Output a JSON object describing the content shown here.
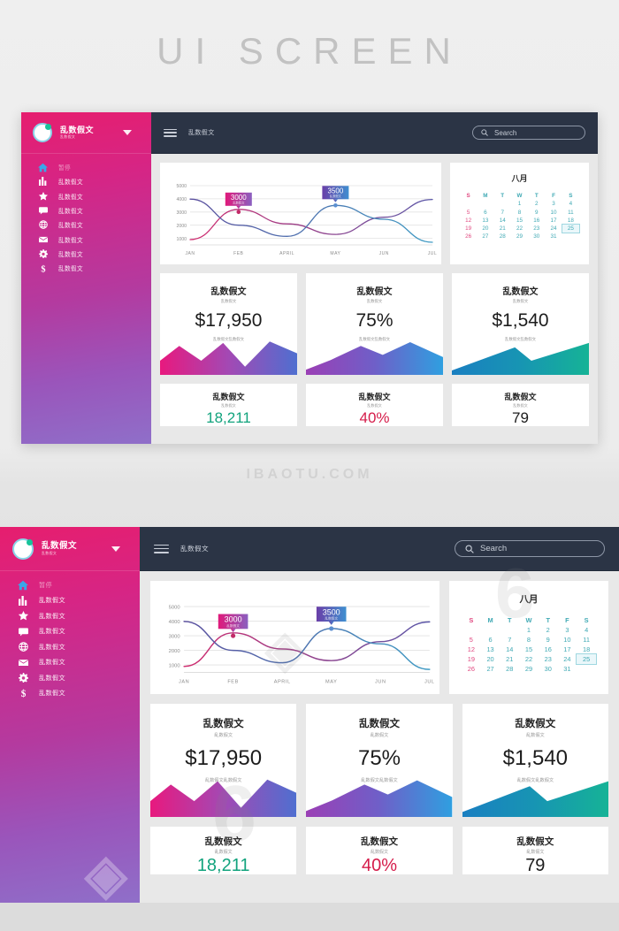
{
  "banner": {
    "title": "UI SCREEN"
  },
  "watermark": {
    "site": "IBAOTU.COM",
    "glyph": "6",
    "diamond": "◈"
  },
  "brand": {
    "name": "乱数假文",
    "subtitle": "乱数假文",
    "caret_icon": "chevron-down-icon",
    "logo_icon": "ring-logo-icon"
  },
  "sidebar": {
    "items": [
      {
        "label": "暂停",
        "icon": "home-icon",
        "active": true
      },
      {
        "label": "乱数假文",
        "icon": "bar-chart-icon",
        "active": false
      },
      {
        "label": "乱数假文",
        "icon": "star-icon",
        "active": false
      },
      {
        "label": "乱数假文",
        "icon": "chat-icon",
        "active": false
      },
      {
        "label": "乱数假文",
        "icon": "globe-icon",
        "active": false
      },
      {
        "label": "乱数假文",
        "icon": "envelope-icon",
        "active": false
      },
      {
        "label": "乱数假文",
        "icon": "gear-icon",
        "active": false
      },
      {
        "label": "乱数假文",
        "icon": "dollar-icon",
        "active": false
      }
    ]
  },
  "topbar": {
    "menu_icon": "hamburger-icon",
    "title": "乱数假文",
    "search": {
      "placeholder": "Search",
      "icon": "search-icon",
      "value": ""
    }
  },
  "calendar": {
    "title": "八月",
    "weekdays": [
      "S",
      "M",
      "T",
      "W",
      "T",
      "F",
      "S"
    ],
    "lead_blanks": 3,
    "days": [
      1,
      2,
      3,
      4,
      5,
      6,
      7,
      8,
      9,
      10,
      11,
      12,
      13,
      14,
      15,
      16,
      17,
      18,
      19,
      20,
      21,
      22,
      23,
      24,
      25,
      26,
      27,
      28,
      29,
      30,
      31
    ],
    "today": 25,
    "sunday_color": "#e0477f",
    "day_color": "#3fa9b4",
    "today_bg": "#eaf7fa"
  },
  "stat_cards": [
    {
      "title": "乱数假文",
      "subtitle": "乱数假文",
      "value": "$17,950",
      "footnote": "乱数假文乱数假文",
      "grad_from": "#e8197e",
      "grad_mid": "#a349b4",
      "grad_to": "#4f6fd0"
    },
    {
      "title": "乱数假文",
      "subtitle": "乱数假文",
      "value": "75%",
      "footnote": "乱数假文乱数假文",
      "grad_from": "#9b3fb5",
      "grad_mid": "#6f5fc8",
      "grad_to": "#2f9fe0"
    },
    {
      "title": "乱数假文",
      "subtitle": "乱数假文",
      "value": "$1,540",
      "footnote": "乱数假文乱数假文",
      "grad_from": "#1a7fc1",
      "grad_mid": "#1795b3",
      "grad_to": "#16b396"
    }
  ],
  "mini_cards": [
    {
      "title": "乱数假文",
      "subtitle": "乱数假文",
      "value": "18,211",
      "color": "#12a37d"
    },
    {
      "title": "乱数假文",
      "subtitle": "乱数假文",
      "value": "40%",
      "color": "#d51c4a"
    },
    {
      "title": "乱数假文",
      "subtitle": "乱数假文",
      "value": "79",
      "color": "#1c1c1c"
    }
  ],
  "chart_data": {
    "type": "line",
    "title": "",
    "xlabel": "",
    "ylabel": "",
    "categories": [
      "JAN",
      "FEB",
      "APRIL",
      "MAY",
      "JUN",
      "JUL"
    ],
    "x_tick_positions": [
      0,
      1,
      2,
      3,
      4,
      5
    ],
    "yticks": [
      1000,
      2000,
      3000,
      4000,
      5000
    ],
    "ylim": [
      500,
      5000
    ],
    "grid": true,
    "legend": "none",
    "series": [
      {
        "name": "series-pink",
        "color": "#b03060",
        "values": [
          900,
          3200,
          2100,
          1300,
          2600,
          3950
        ],
        "stroke_from": "#d12b6e",
        "stroke_to": "#5a57a8"
      },
      {
        "name": "series-blue",
        "color": "#4a7fb5",
        "values": [
          3980,
          2000,
          1150,
          3500,
          2450,
          700
        ],
        "stroke_from": "#5b4f9e",
        "stroke_to": "#3f9bc4"
      }
    ],
    "annotations": [
      {
        "label": "3000",
        "sub": "乱数假文",
        "series": "series-pink",
        "x": "FEB",
        "value": 3000,
        "grad_from": "#e0197a",
        "grad_to": "#8a5fc0",
        "dot": "#c22a68"
      },
      {
        "label": "3500",
        "sub": "乱数假文",
        "series": "series-blue",
        "x": "MAY",
        "value": 3500,
        "grad_from": "#6a3fa8",
        "grad_to": "#3f8fd0",
        "dot": "#5b8fd0"
      }
    ]
  }
}
